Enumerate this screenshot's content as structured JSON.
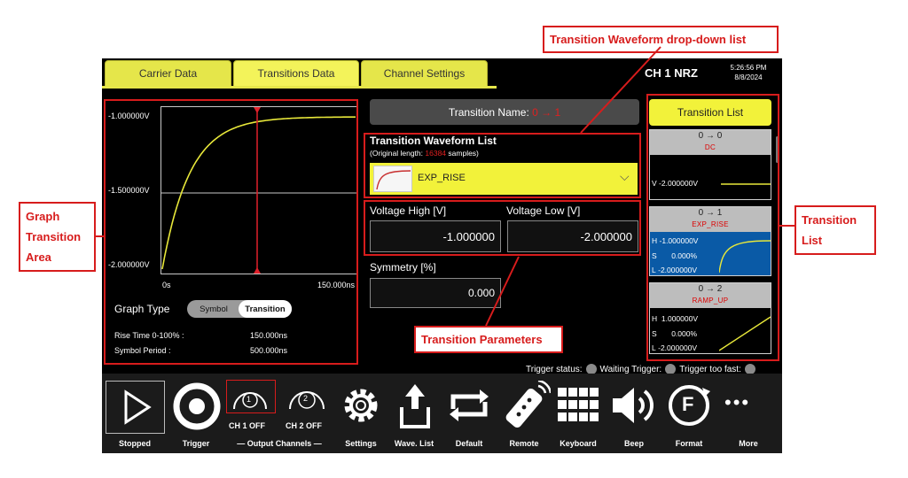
{
  "tabs": [
    {
      "label": "Carrier Data"
    },
    {
      "label": "Transitions Data"
    },
    {
      "label": "Channel Settings"
    }
  ],
  "header": {
    "channel": "CH 1 NRZ",
    "time": "5:26:56 PM",
    "date": "8/8/2024"
  },
  "graph": {
    "y_ticks": [
      "-1.000000V",
      "-1.500000V",
      "-2.000000V"
    ],
    "x_start": "0s",
    "x_end": "150.000ns",
    "graph_type_label": "Graph Type",
    "options": [
      "Symbol",
      "Transition"
    ],
    "selected_option": "Transition",
    "rise_time_label": "Rise Time 0-100% :",
    "rise_time_value": "150.000ns",
    "symbol_period_label": "Symbol Period :",
    "symbol_period_value": "500.000ns"
  },
  "transition_name": {
    "label": "Transition Name:",
    "value": "0 → 1"
  },
  "waveform_list": {
    "title": "Transition Waveform List",
    "orig_prefix": "(Original length:",
    "orig_value": "16384",
    "orig_suffix": "samples)",
    "selected": "EXP_RISE",
    "chevron": "⌵"
  },
  "params": {
    "voltage_high_label": "Voltage High [V]",
    "voltage_high_value": "-1.000000",
    "voltage_low_label": "Voltage Low [V]",
    "voltage_low_value": "-2.000000",
    "symmetry_label": "Symmetry [%]",
    "symmetry_value": "0.000"
  },
  "transition_list": {
    "title": "Transition List",
    "items": [
      {
        "arrow": "0 → 0",
        "name": "DC",
        "rows": [
          {
            "k": "V",
            "v": "-2.000000V"
          }
        ]
      },
      {
        "arrow": "0 → 1",
        "name": "EXP_RISE",
        "rows": [
          {
            "k": "H",
            "v": "-1.000000V"
          },
          {
            "k": "S",
            "v": "0.000%"
          },
          {
            "k": "L",
            "v": "-2.000000V"
          }
        ]
      },
      {
        "arrow": "0 → 2",
        "name": "RAMP_UP",
        "rows": [
          {
            "k": "H",
            "v": "1.000000V"
          },
          {
            "k": "S",
            "v": "0.000%"
          },
          {
            "k": "L",
            "v": "-2.000000V"
          }
        ]
      }
    ]
  },
  "trigger": {
    "status": "Trigger status:",
    "waiting": "Waiting Trigger:",
    "too_fast": "Trigger too fast:"
  },
  "toolbar": {
    "stopped": "Stopped",
    "trigger": "Trigger",
    "ch1": "CH 1 OFF",
    "ch2": "CH 2 OFF",
    "ch1_num": "1",
    "ch2_num": "2",
    "output_channels": "— Output Channels —",
    "settings": "Settings",
    "wave_list": "Wave. List",
    "default": "Default",
    "remote": "Remote",
    "keyboard": "Keyboard",
    "beep": "Beep",
    "format": "Format",
    "more": "More",
    "format_letter": "F",
    "more_dots": "•••"
  },
  "annotations": {
    "dropdown": "Transition Waveform drop-down list",
    "graph_area": "Graph\nTransition\nArea",
    "parameters": "Transition Parameters",
    "list": "Transition\nList"
  },
  "colors": {
    "tab": "#e5e64a",
    "accent_red": "#d71c1c",
    "curve": "#e8e83a",
    "cursor": "#e0202a",
    "selected_blue": "#0a5aa6"
  }
}
